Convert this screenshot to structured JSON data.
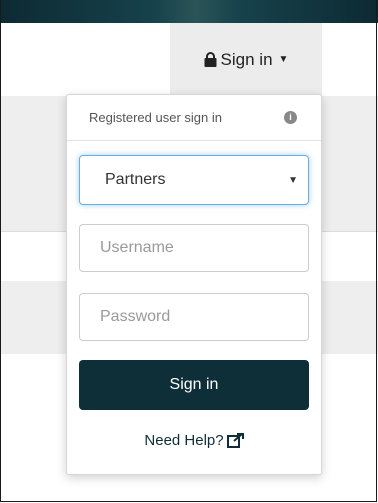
{
  "header": {
    "signin_label": "Sign in",
    "lock_icon": "lock-icon",
    "caret_icon": "caret-down-icon"
  },
  "dropdown": {
    "title": "Registered user sign in",
    "info_icon": "info-icon",
    "user_type": {
      "selected": "Partners",
      "options": [
        "Partners"
      ]
    },
    "username_placeholder": "Username",
    "password_placeholder": "Password",
    "submit_label": "Sign in",
    "help_label": "Need Help?",
    "help_icon": "external-link-icon"
  },
  "colors": {
    "topbar": "#0d2a33",
    "button": "#0e2f38",
    "focus_border": "#66afe9"
  }
}
